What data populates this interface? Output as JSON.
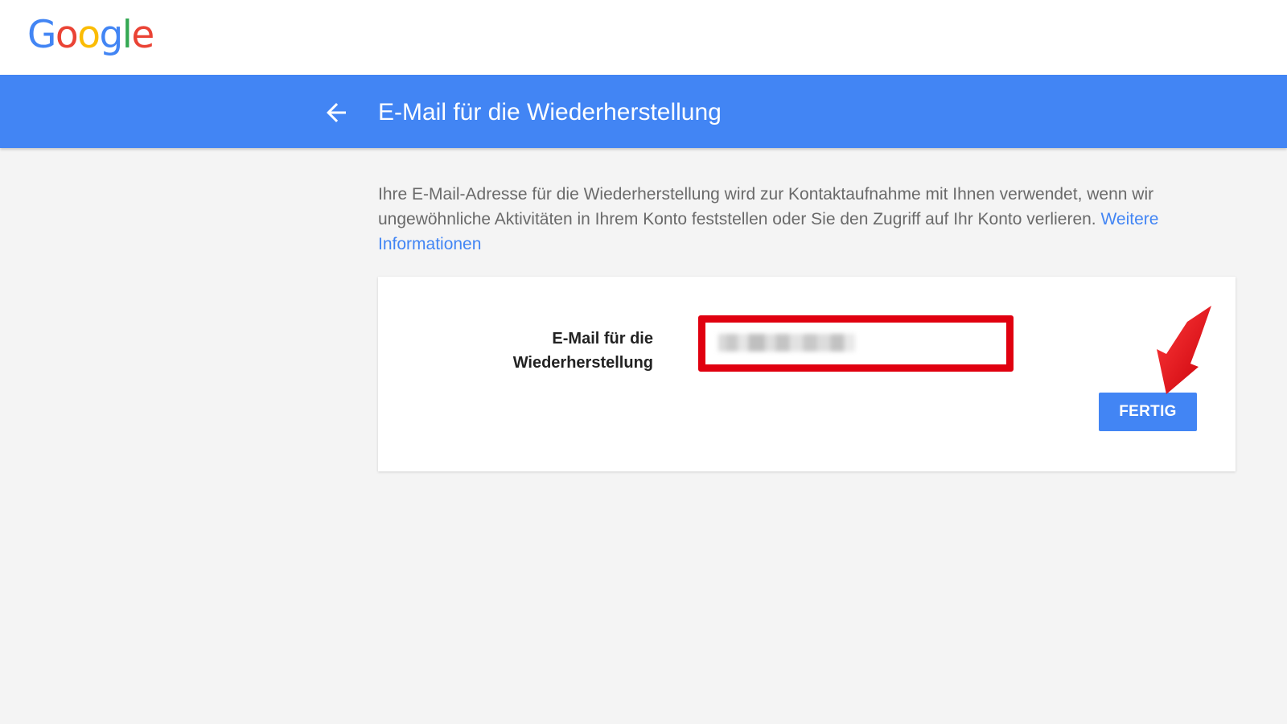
{
  "header": {
    "logo_letters": [
      {
        "char": "G",
        "color": "#4285f4"
      },
      {
        "char": "o",
        "color": "#ea4335"
      },
      {
        "char": "o",
        "color": "#fbbc05"
      },
      {
        "char": "g",
        "color": "#4285f4"
      },
      {
        "char": "l",
        "color": "#34a853"
      },
      {
        "char": "e",
        "color": "#ea4335"
      }
    ]
  },
  "title_bar": {
    "back_icon": "arrow-back-icon",
    "title": "E-Mail für die Wiederherstellung",
    "background": "#4285f4"
  },
  "description": {
    "text": "Ihre E-Mail-Adresse für die Wiederherstellung wird zur Kontaktaufnahme mit Ihnen verwendet, wenn wir ungewöhnliche Aktivitäten in Ihrem Konto feststellen oder Sie den Zugriff auf Ihr Konto verlieren. ",
    "link_text": "Weitere Informationen"
  },
  "form": {
    "field_label": "E-Mail für die Wiederherstellung",
    "field_value": "",
    "done_button": "FERTIG"
  },
  "colors": {
    "accent": "#4285f4",
    "highlight_box": "#e0000f",
    "annotation_arrow": "#e0000f"
  }
}
